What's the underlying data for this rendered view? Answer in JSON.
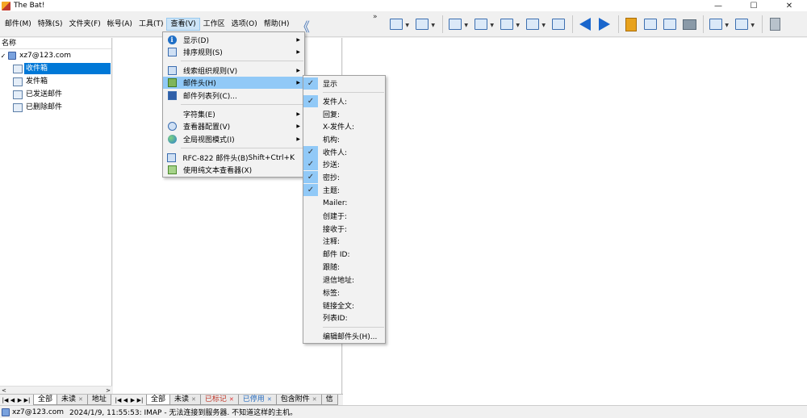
{
  "window": {
    "title": "The Bat!",
    "controls": [
      "—",
      "☐",
      "✕"
    ]
  },
  "menubar": {
    "items": [
      "邮件(M)",
      "特殊(S)",
      "文件夹(F)",
      "帐号(A)",
      "工具(T)",
      "查看(V)",
      "工作区",
      "选项(O)",
      "帮助(H)"
    ],
    "active_index": 5
  },
  "toolbar": {
    "more_glyph": "»",
    "back_glyph": "《"
  },
  "left_panel": {
    "header": "名称",
    "account": "xz7@123.com",
    "folders": [
      {
        "label": "收件箱",
        "icon": "inbox-icon",
        "selected": true
      },
      {
        "label": "发件箱",
        "icon": "outbox-icon",
        "selected": false
      },
      {
        "label": "已发送邮件",
        "icon": "sent-icon",
        "selected": false
      },
      {
        "label": "已删除邮件",
        "icon": "trash-icon",
        "selected": false
      }
    ]
  },
  "view_menu": {
    "items": [
      {
        "label": "显示(D)",
        "icon": "info-icon",
        "submenu": true
      },
      {
        "label": "排序规则(S)",
        "icon": "sort-icon",
        "submenu": true
      },
      {
        "separator": true
      },
      {
        "label": "线索组织规则(V)",
        "icon": "thread-icon",
        "submenu": true
      },
      {
        "label": "邮件头(H)",
        "icon": "header-icon",
        "submenu": true,
        "highlighted": true
      },
      {
        "label": "邮件列表列(C)...",
        "icon": "columns-icon",
        "submenu": false
      },
      {
        "separator": true
      },
      {
        "label": "字符集(E)",
        "icon": "",
        "submenu": true
      },
      {
        "label": "查看器配置(V)",
        "icon": "viewer-config-icon",
        "submenu": true
      },
      {
        "label": "全局视图模式(I)",
        "icon": "globe-icon",
        "submenu": true
      },
      {
        "separator": true
      },
      {
        "label": "RFC-822 邮件头(B)",
        "icon": "rfc-icon",
        "submenu": false,
        "shortcut": "Shift+Ctrl+K"
      },
      {
        "label": "使用纯文本查看器(X)",
        "icon": "plaintext-icon",
        "submenu": false
      }
    ]
  },
  "header_submenu": {
    "items": [
      {
        "label": "显示",
        "checked": true
      },
      {
        "separator": true
      },
      {
        "label": "发件人:",
        "checked": true
      },
      {
        "label": "回复:",
        "checked": false
      },
      {
        "label": "X-发件人:",
        "checked": false
      },
      {
        "label": "机构:",
        "checked": false
      },
      {
        "label": "收件人:",
        "checked": true
      },
      {
        "label": "抄送:",
        "checked": true
      },
      {
        "label": "密抄:",
        "checked": true
      },
      {
        "label": "主题:",
        "checked": true
      },
      {
        "label": "Mailer:",
        "checked": false
      },
      {
        "label": "创建于:",
        "checked": false
      },
      {
        "label": "接收于:",
        "checked": false
      },
      {
        "label": "注释:",
        "checked": false
      },
      {
        "label": "邮件 ID:",
        "checked": false
      },
      {
        "label": "跟随:",
        "checked": false
      },
      {
        "label": "退信地址:",
        "checked": false
      },
      {
        "label": "标签:",
        "checked": false
      },
      {
        "label": "链接全文:",
        "checked": false
      },
      {
        "label": "列表ID:",
        "checked": false
      },
      {
        "separator": true
      },
      {
        "label": "编辑邮件头(H)...",
        "checked": false
      }
    ]
  },
  "left_tabs": {
    "nav": [
      "|◀",
      "◀",
      "▶",
      "▶|"
    ],
    "tabs": [
      {
        "label": "全部",
        "close": "",
        "active": true
      },
      {
        "label": "未读",
        "close": "✕",
        "active": false
      },
      {
        "label": "地址",
        "close": "",
        "active": false
      }
    ]
  },
  "msg_tabs": {
    "nav": [
      "|◀",
      "◀",
      "▶",
      "▶|"
    ],
    "tabs": [
      {
        "label": "全部",
        "close": "",
        "active": true
      },
      {
        "label": "未读",
        "close": "✕",
        "active": false
      },
      {
        "label": "已标记",
        "close": "✕",
        "active": false
      },
      {
        "label": "已停用",
        "close": "✕",
        "active": false
      },
      {
        "label": "包含附件",
        "close": "✕",
        "active": false
      },
      {
        "label": "信",
        "close": "",
        "active": false
      }
    ]
  },
  "statusbar": {
    "account": "xz7@123.com",
    "message": "2024/1/9, 11:55:53: IMAP  - 无法连接到服务器. 不知道这样的主机。"
  },
  "colors": {
    "selection": "#0078d7",
    "menu_highlight": "#91c9f7",
    "accent": "#1a66cc"
  }
}
